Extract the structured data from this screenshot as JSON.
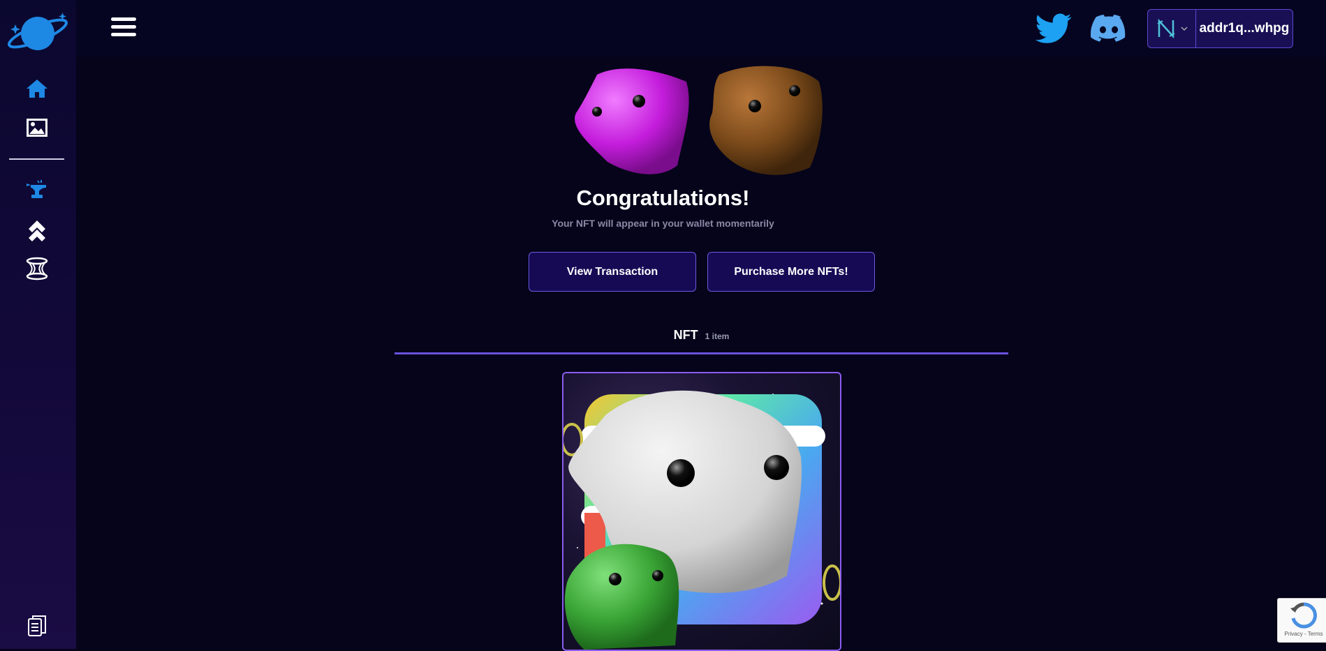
{
  "sidebar": {
    "icons": [
      "planet-logo-icon",
      "home-icon",
      "gallery-icon",
      "anvil-icon",
      "double-chevron-up-icon",
      "wormhole-icon",
      "documents-icon"
    ]
  },
  "header": {
    "menu_icon": "hamburger-icon",
    "twitter_icon": "twitter-icon",
    "discord_icon": "discord-icon",
    "wallet": {
      "provider_icon": "nami-wallet-icon",
      "address": "addr1q...whpg"
    }
  },
  "main": {
    "title": "Congratulations!",
    "subtitle": "Your NFT will appear in your wallet momentarily",
    "buttons": {
      "view": "View Transaction",
      "purchase": "Purchase More NFTs!"
    },
    "tab": {
      "label": "NFT",
      "count": "1 item"
    }
  },
  "recaptcha": {
    "links": "Privacy - Terms"
  },
  "colors": {
    "accent": "#6a52e0",
    "button_bg": "#170a55",
    "background": "#05041a",
    "icon_blue": "#1e88e5",
    "twitter": "#1da1f2"
  }
}
